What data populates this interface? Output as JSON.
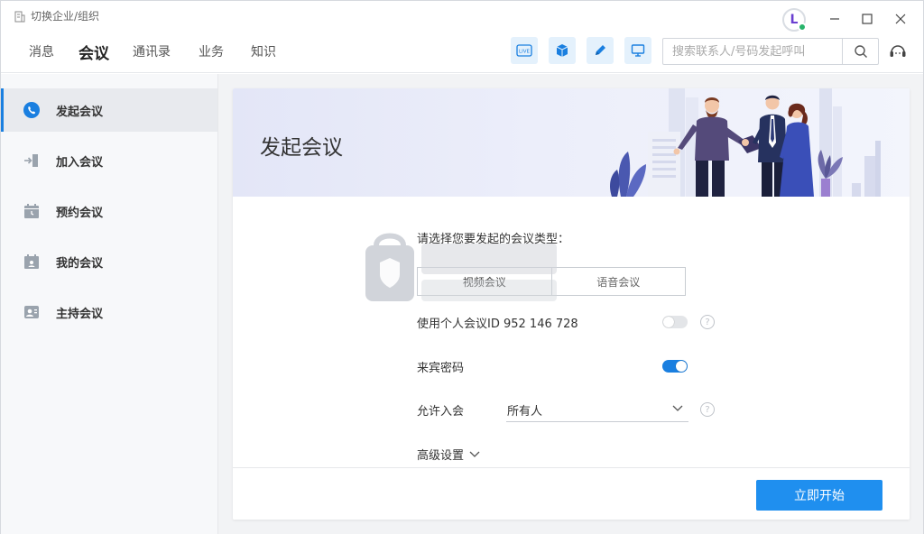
{
  "titlebar": {
    "org_switch_label": "切换企业/组织",
    "avatar_letter": "L"
  },
  "nav": {
    "tabs": [
      {
        "label": "消息",
        "active": false
      },
      {
        "label": "会议",
        "active": true
      },
      {
        "label": "通讯录",
        "active": false
      },
      {
        "label": "业务",
        "active": false
      },
      {
        "label": "知识",
        "active": false
      }
    ],
    "tools": [
      "live-icon",
      "box-icon",
      "pen-icon",
      "screen-icon"
    ],
    "search_placeholder": "搜索联系人/号码发起呼叫"
  },
  "sidebar": {
    "items": [
      {
        "label": "发起会议",
        "icon": "phone-chat-icon",
        "active": true
      },
      {
        "label": "加入会议",
        "icon": "enter-door-icon",
        "active": false
      },
      {
        "label": "预约会议",
        "icon": "calendar-clock-icon",
        "active": false
      },
      {
        "label": "我的会议",
        "icon": "calendar-person-icon",
        "active": false
      },
      {
        "label": "主持会议",
        "icon": "host-person-icon",
        "active": false
      }
    ]
  },
  "main": {
    "banner_title": "发起会议",
    "prompt": "请选择您要发起的会议类型：",
    "meeting_types": [
      {
        "label": "视频会议",
        "selected": true
      },
      {
        "label": "语音会议",
        "selected": false
      }
    ],
    "personal_id_label": "使用个人会议ID 952 146 728",
    "personal_id_enabled": false,
    "guest_password_label": "来宾密码",
    "guest_password_enabled": true,
    "allow_join_label": "允许入会",
    "allow_join_value": "所有人",
    "advanced_label": "高级设置",
    "start_button": "立即开始"
  },
  "colors": {
    "accent": "#1f8fef",
    "sidebar_active_bar": "#1a7fe0",
    "banner_bg": "#e3e6f7"
  }
}
